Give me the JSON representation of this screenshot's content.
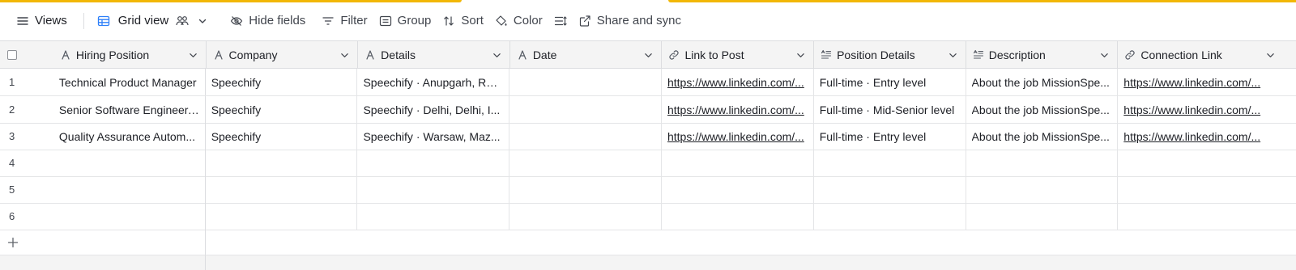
{
  "toolbar": {
    "views_label": "Views",
    "view_name": "Grid view",
    "hide_fields_label": "Hide fields",
    "filter_label": "Filter",
    "group_label": "Group",
    "sort_label": "Sort",
    "color_label": "Color",
    "share_label": "Share and sync"
  },
  "accent_color": "#f2b705",
  "columns": [
    {
      "label": "Hiring Position",
      "icon": "text-type-icon"
    },
    {
      "label": "Company",
      "icon": "text-type-icon"
    },
    {
      "label": "Details",
      "icon": "text-type-icon"
    },
    {
      "label": "Date",
      "icon": "text-type-icon"
    },
    {
      "label": "Link to Post",
      "icon": "link-icon"
    },
    {
      "label": "Position Details",
      "icon": "long-text-icon"
    },
    {
      "label": "Description",
      "icon": "long-text-icon"
    },
    {
      "label": "Connection Link",
      "icon": "link-icon"
    }
  ],
  "rows": [
    {
      "num": "1",
      "cells": [
        "Technical Product Manager",
        "Speechify",
        "Speechify · Anupgarh, Raj...",
        "",
        "https://www.linkedin.com/...",
        "Full-time · Entry level",
        "About the job MissionSpe...",
        "https://www.linkedin.com/..."
      ]
    },
    {
      "num": "2",
      "cells": [
        "Senior Software Engineer,...",
        "Speechify",
        "Speechify · Delhi, Delhi, I...",
        "",
        "https://www.linkedin.com/...",
        "Full-time · Mid-Senior level",
        "About the job MissionSpe...",
        "https://www.linkedin.com/..."
      ]
    },
    {
      "num": "3",
      "cells": [
        "Quality Assurance Autom...",
        "Speechify",
        "Speechify · Warsaw, Maz...",
        "",
        "https://www.linkedin.com/...",
        "Full-time · Entry level",
        "About the job MissionSpe...",
        "https://www.linkedin.com/..."
      ]
    },
    {
      "num": "4",
      "cells": [
        "",
        "",
        "",
        "",
        "",
        "",
        "",
        ""
      ]
    },
    {
      "num": "5",
      "cells": [
        "",
        "",
        "",
        "",
        "",
        "",
        "",
        ""
      ]
    },
    {
      "num": "6",
      "cells": [
        "",
        "",
        "",
        "",
        "",
        "",
        "",
        ""
      ]
    }
  ]
}
